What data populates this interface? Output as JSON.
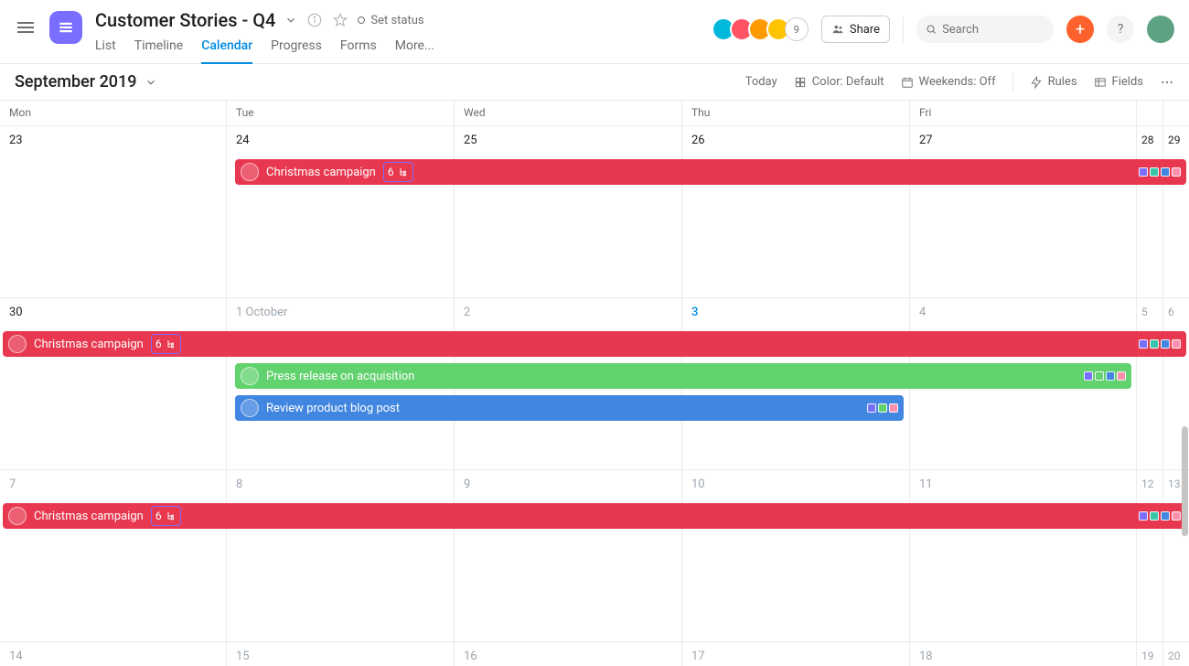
{
  "header": {
    "project_title": "Customer Stories - Q4",
    "set_status": "Set status",
    "tabs": {
      "list": "List",
      "timeline": "Timeline",
      "calendar": "Calendar",
      "progress": "Progress",
      "forms": "Forms",
      "more": "More..."
    },
    "avatar_overflow": "9",
    "share_label": "Share",
    "search_placeholder": "Search"
  },
  "toolbar": {
    "month_label": "September 2019",
    "today": "Today",
    "color": "Color: Default",
    "weekends": "Weekends: Off",
    "rules": "Rules",
    "fields": "Fields"
  },
  "weekdays": {
    "mon": "Mon",
    "tue": "Tue",
    "wed": "Wed",
    "thu": "Thu",
    "fri": "Fri"
  },
  "dates": {
    "w1": {
      "mon": "23",
      "tue": "24",
      "wed": "25",
      "thu": "26",
      "fri": "27",
      "sat": "28",
      "sun": "29"
    },
    "w2": {
      "mon": "30",
      "tue": "1 October",
      "wed": "2",
      "thu": "3",
      "fri": "4",
      "sat": "5",
      "sun": "6"
    },
    "w3": {
      "mon": "7",
      "tue": "8",
      "wed": "9",
      "thu": "10",
      "fri": "11",
      "sat": "12",
      "sun": "13"
    },
    "w4": {
      "mon": "14",
      "tue": "15",
      "wed": "16",
      "thu": "17",
      "fri": "18",
      "sat": "19",
      "sun": "20"
    }
  },
  "events": {
    "christmas_title": "Christmas campaign",
    "christmas_sub": "6",
    "press_title": "Press release on acquisition",
    "review_title": "Review product blog post"
  }
}
